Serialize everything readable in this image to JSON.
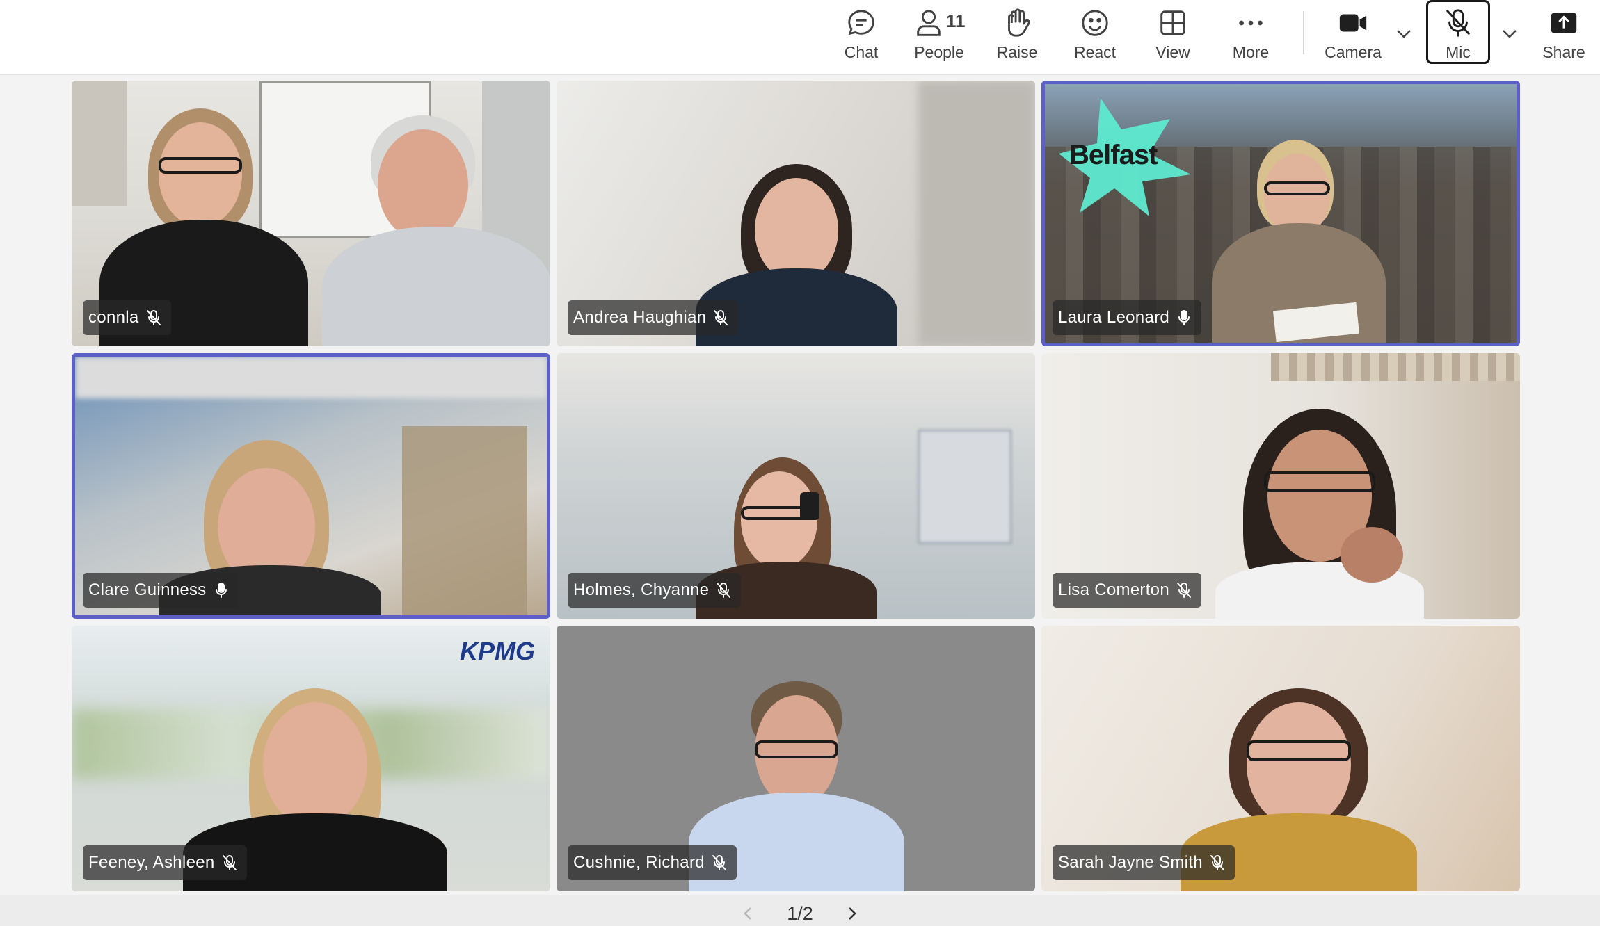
{
  "toolbar": {
    "chat_label": "Chat",
    "people_label": "People",
    "people_count": "11",
    "raise_label": "Raise",
    "react_label": "React",
    "view_label": "View",
    "more_label": "More",
    "camera_label": "Camera",
    "mic_label": "Mic",
    "share_label": "Share"
  },
  "participants": [
    {
      "name": "connla",
      "mic": "muted",
      "active": false
    },
    {
      "name": "Andrea Haughian",
      "mic": "muted",
      "active": false
    },
    {
      "name": "Laura Leonard",
      "mic": "on",
      "active": true
    },
    {
      "name": "Clare Guinness",
      "mic": "on",
      "active": true
    },
    {
      "name": "Holmes, Chyanne",
      "mic": "muted",
      "active": false
    },
    {
      "name": "Lisa Comerton",
      "mic": "muted",
      "active": false
    },
    {
      "name": "Feeney, Ashleen",
      "mic": "muted",
      "active": false
    },
    {
      "name": "Cushnie, Richard",
      "mic": "muted",
      "active": false
    },
    {
      "name": "Sarah Jayne Smith",
      "mic": "muted",
      "active": false
    }
  ],
  "backgrounds": {
    "belfast_text": "Belfast",
    "kpmg_text": "KPMG"
  },
  "pager": {
    "label": "1/2"
  },
  "colors": {
    "accent": "#5b5fc7",
    "name_tag_bg": "#282828"
  }
}
